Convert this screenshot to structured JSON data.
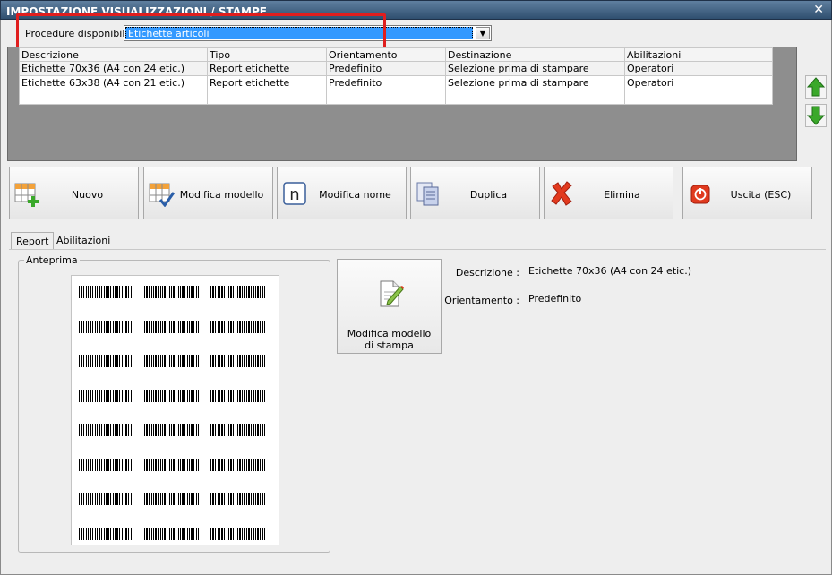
{
  "window": {
    "title": "IMPOSTAZIONE VISUALIZZAZIONI / STAMPE",
    "close_glyph": "✕"
  },
  "procedure": {
    "label": "Procedure disponibili :",
    "selected": "Etichette articoli"
  },
  "grid": {
    "columns": [
      "Descrizione",
      "Tipo",
      "Orientamento",
      "Destinazione",
      "Abilitazioni"
    ],
    "rows": [
      [
        "Etichette 70x36 (A4 con 24 etic.)",
        "Report etichette",
        "Predefinito",
        "Selezione prima di stampare",
        "Operatori"
      ],
      [
        "Etichette 63x38 (A4 con 21 etic.)",
        "Report etichette",
        "Predefinito",
        "Selezione prima di stampare",
        "Operatori"
      ]
    ]
  },
  "toolbar": {
    "nuovo": "Nuovo",
    "modifica_modello": "Modifica modello",
    "modifica_nome": "Modifica nome",
    "duplica": "Duplica",
    "elimina": "Elimina",
    "uscita": "Uscita (ESC)",
    "icon_name_letter": "n"
  },
  "tabs": [
    "Report",
    "Abilitazioni"
  ],
  "preview": {
    "legend": "Anteprima",
    "label_rows": 8,
    "label_cols": 3
  },
  "edit_model": {
    "label": "Modifica modello di stampa"
  },
  "info": {
    "descrizione_label": "Descrizione :",
    "descrizione_value": "Etichette 70x36 (A4 con 24 etic.)",
    "orientamento_label": "Orientamento :",
    "orientamento_value": "Predefinito"
  },
  "colors": {
    "highlight": "#e01e1e",
    "selection": "#3399ff",
    "grid_background": "#8e8e8e",
    "arrow_green": "#3aa82a"
  }
}
